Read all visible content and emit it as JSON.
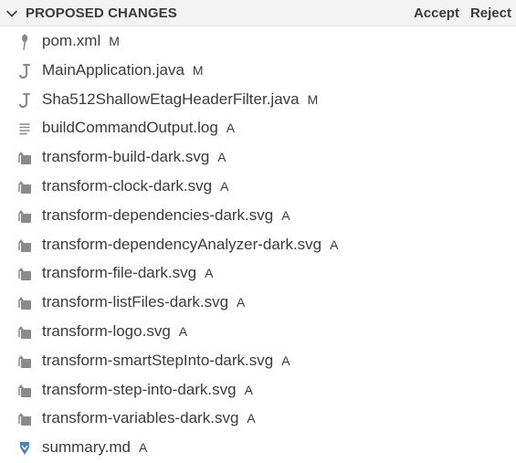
{
  "header": {
    "title": "PROPOSED CHANGES",
    "accept_label": "Accept",
    "reject_label": "Reject"
  },
  "files": [
    {
      "name": "pom.xml",
      "status": "M",
      "icon": "xml-file-icon"
    },
    {
      "name": "MainApplication.java",
      "status": "M",
      "icon": "java-file-icon"
    },
    {
      "name": "Sha512ShallowEtagHeaderFilter.java",
      "status": "M",
      "icon": "java-file-icon"
    },
    {
      "name": "buildCommandOutput.log",
      "status": "A",
      "icon": "log-file-icon"
    },
    {
      "name": "transform-build-dark.svg",
      "status": "A",
      "icon": "image-file-icon"
    },
    {
      "name": "transform-clock-dark.svg",
      "status": "A",
      "icon": "image-file-icon"
    },
    {
      "name": "transform-dependencies-dark.svg",
      "status": "A",
      "icon": "image-file-icon"
    },
    {
      "name": "transform-dependencyAnalyzer-dark.svg",
      "status": "A",
      "icon": "image-file-icon"
    },
    {
      "name": "transform-file-dark.svg",
      "status": "A",
      "icon": "image-file-icon"
    },
    {
      "name": "transform-listFiles-dark.svg",
      "status": "A",
      "icon": "image-file-icon"
    },
    {
      "name": "transform-logo.svg",
      "status": "A",
      "icon": "image-file-icon"
    },
    {
      "name": "transform-smartStepInto-dark.svg",
      "status": "A",
      "icon": "image-file-icon"
    },
    {
      "name": "transform-step-into-dark.svg",
      "status": "A",
      "icon": "image-file-icon"
    },
    {
      "name": "transform-variables-dark.svg",
      "status": "A",
      "icon": "image-file-icon"
    },
    {
      "name": "summary.md",
      "status": "A",
      "icon": "markdown-file-icon"
    }
  ],
  "colors": {
    "header_bg": "#f3f3f3",
    "text": "#3b3b3b",
    "icon_gray": "#8a8a8a",
    "markdown_blue": "#4a7fc1"
  }
}
